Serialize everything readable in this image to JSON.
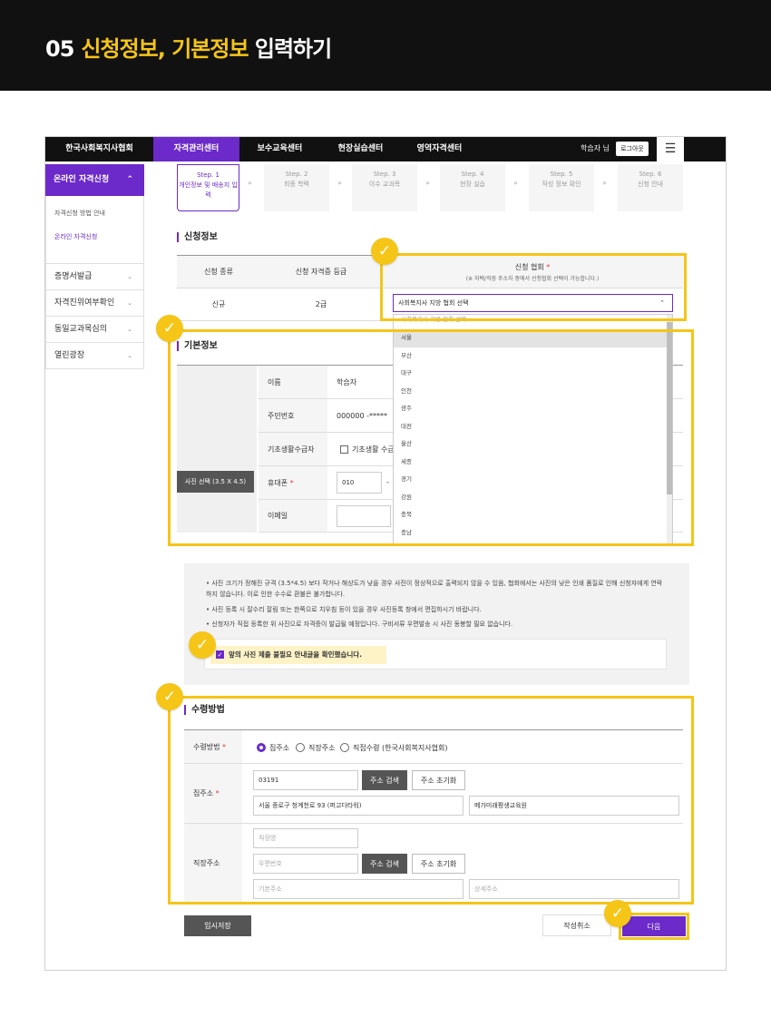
{
  "banner": {
    "num": "05",
    "hl1": "신청정보,",
    "hl2": "기본정보",
    "rest": "입력하기"
  },
  "gnb": {
    "menus": [
      "한국사회복지사협회",
      "자격관리센터",
      "보수교육센터",
      "현장실습센터",
      "영역자격센터"
    ],
    "user": "학습자 님",
    "logout": "로그아웃",
    "menu_icon": "hamburger-icon"
  },
  "lnb": {
    "title": "온라인 자격신청",
    "sub": [
      "자격신청 방법 안내",
      "온라인 자격신청"
    ],
    "items": [
      "증명서발급",
      "자격진위여부확인",
      "동일교과목심의",
      "열린광장"
    ]
  },
  "steps": [
    {
      "no": "Step. 1",
      "label": "개인정보 및 배송지 입력"
    },
    {
      "no": "Step. 2",
      "label": "최종 학력"
    },
    {
      "no": "Step. 3",
      "label": "이수 교과목"
    },
    {
      "no": "Step. 4",
      "label": "현장 실습"
    },
    {
      "no": "Step. 5",
      "label": "작성 정보 확인"
    },
    {
      "no": "Step. 6",
      "label": "신청 안내"
    }
  ],
  "apply": {
    "title": "신청정보",
    "h_type": "신청 종류",
    "h_grade": "신청 자격증 등급",
    "h_assoc": "신청 협회",
    "h_assoc_note": "(※ 자택/직장 주소지 중에서 신청협회 선택이 가능합니다.)",
    "type": "신규",
    "grade": "2급",
    "select": "사회복지사 지방 협회 선택"
  },
  "dropdown": {
    "top": "사회복지사 지방 협회 선택",
    "options": [
      "서울",
      "부산",
      "대구",
      "인천",
      "광주",
      "대전",
      "울산",
      "세종",
      "경기",
      "강원",
      "충북",
      "충남"
    ]
  },
  "basic": {
    "title": "기본정보",
    "photo_btn": "사진 선택 (3.5 X 4.5)",
    "l_name": "이름",
    "name": "학습자",
    "l_rrn": "주민번호",
    "rrn": "000000 -*****",
    "l_basic": "기초생활수급자",
    "basic_cb": "기초생활 수급",
    "l_phone": "휴대폰",
    "phone1": "010",
    "phone_dash": "-",
    "l_email": "이메일"
  },
  "notice": {
    "lines": [
      "사진 크기가 정해진 규격 (3.5*4.5) 보다 작거나 해상도가 낮을 경우 사진이 정상적으로 출력되지 않을 수 있음, 협회에서는 사진의 낮은 인쇄 품질로 인해 신청자에게 연락하지 않습니다. 이로 인한 수수료 환불은 불가합니다.",
      "사진 등록 시 잘수리 잘림 또는 한쪽으로 치우침 등이 있을 경우 사진등록 창에서 편집하시기 바랍니다.",
      "신청자가 직접 등록한 위 사진으로 자격증이 발급될 예정입니다. 구비서류 우편발송 시 사진 동봉할 필요 없습니다."
    ],
    "agree": "앞의 사진 제출 불필요 안내글을 확인했습니다."
  },
  "receive": {
    "title": "수령방법",
    "l_method": "수령방법",
    "opt1": "집주소",
    "opt2": "직장주소",
    "opt3": "직접수령 (한국사회복지사협회)",
    "l_home": "집주소",
    "zip": "03191",
    "addr1": "서울 종로구 청계천로 93 (퍼고다타워)",
    "addr2": "메가미래평생교육원",
    "btn_search": "주소 검색",
    "btn_reset": "주소 초기화",
    "l_work": "직장주소",
    "ph_company": "직장명",
    "ph_zip": "우편번호",
    "ph_addr1": "기본주소",
    "ph_addr2": "상세주소"
  },
  "footer": {
    "save": "임시저장",
    "cancel": "작성취소",
    "next": "다음"
  },
  "colors": {
    "accent": "#6b2ac9",
    "highlight": "#f5c518"
  }
}
